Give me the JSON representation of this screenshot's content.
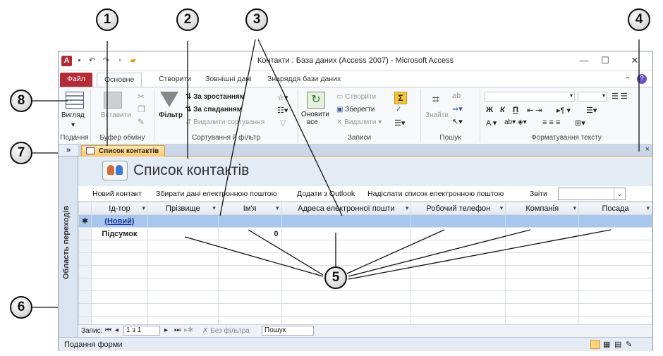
{
  "window": {
    "title": "Контакти : База даних (Access 2007)  -  Microsoft Access",
    "app_icon": "A"
  },
  "ribbon_tabs": [
    "Файл",
    "Основне",
    "Створити",
    "Зовнішні дані",
    "Знаряддя бази даних"
  ],
  "ribbon": {
    "views": {
      "button": "Вигляд",
      "group": "Подання"
    },
    "clipboard": {
      "paste": "Вставити",
      "group": "Буфер обміну"
    },
    "sort_filter": {
      "filter": "Фільтр",
      "asc": "За зростанням",
      "desc": "За спаданням",
      "remove": "Видалити сортування",
      "group": "Сортування й фільтр"
    },
    "records": {
      "refresh": "Оновити",
      "refresh_all": "все",
      "new": "Створити",
      "save": "Зберегти",
      "delete": "Видалити",
      "group": "Записи"
    },
    "find": {
      "find": "Знайти",
      "group": "Пошук"
    },
    "text_format": {
      "group": "Форматування тексту",
      "bold": "Ж",
      "italic": "К",
      "underline": "П",
      "font_color": "A"
    }
  },
  "nav_pane": {
    "toggle": "»",
    "label": "Область переходів"
  },
  "document": {
    "tab": "Список контактів",
    "close": "×",
    "form_title": "Список контактів",
    "commands": [
      "Новий контакт",
      "Збирати дані електронною поштою",
      "Додати з Outlook",
      "Надіслати список електронною поштою",
      "Звіти"
    ],
    "combo_arrow": "⌄"
  },
  "table": {
    "columns": [
      "Ід-тор",
      "Прізвище",
      "Ім'я",
      "Адреса електронної пошти",
      "Робочий телефон",
      "Компанія",
      "Посада"
    ],
    "new_row_marker": "✱",
    "new_row_value": "(Новий)",
    "total_label": "Підсумок",
    "total_value": "0"
  },
  "record_nav": {
    "label": "Запис:",
    "position": "1 з 1",
    "filter": "Без фільтра",
    "search": "Пошук"
  },
  "statusbar": {
    "text": "Подання форми"
  },
  "callouts": [
    "1",
    "2",
    "3",
    "4",
    "5",
    "6",
    "7",
    "8"
  ]
}
